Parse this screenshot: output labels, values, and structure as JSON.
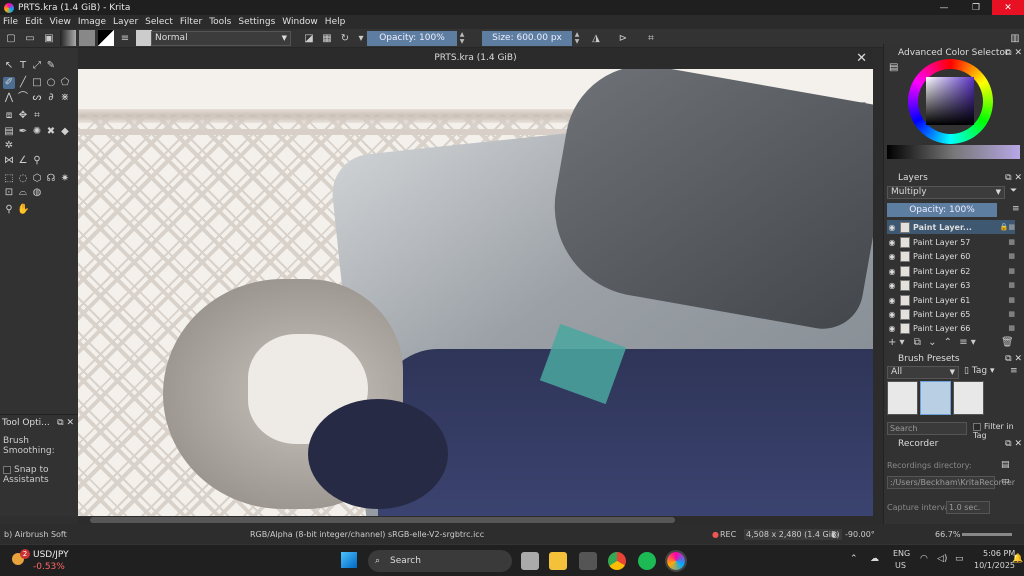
{
  "window": {
    "title": "PRTS.kra (1.4 GiB)  - Krita",
    "min": "—",
    "max": "❐",
    "close": "✕"
  },
  "menu": [
    "File",
    "Edit",
    "View",
    "Image",
    "Layer",
    "Select",
    "Filter",
    "Tools",
    "Settings",
    "Window",
    "Help"
  ],
  "toolbar": {
    "blend_mode": "Normal",
    "opacity": "Opacity: 100%",
    "size": "Size: 600.00 px"
  },
  "canvas": {
    "title": "PRTS.kra (1.4 GiB)",
    "close": "✕"
  },
  "tool_options": {
    "title": "Tool Opti...",
    "smoothing": "Brush Smoothing:",
    "snap": "Snap to Assistants"
  },
  "color_selector": {
    "title": "Advanced Color Selector"
  },
  "layers": {
    "title": "Layers",
    "blend": "Multiply",
    "opacity": "Opacity:  100%",
    "items": [
      "Paint Layer...",
      "Paint Layer 57",
      "Paint Layer 60",
      "Paint Layer 62",
      "Paint Layer 63",
      "Paint Layer 61",
      "Paint Layer 65",
      "Paint Layer 66"
    ]
  },
  "brush_presets": {
    "title": "Brush Presets",
    "filter": "All",
    "tag": "Tag",
    "search": "Search",
    "filter_in_tag": "Filter in Tag"
  },
  "recorder": {
    "title": "Recorder",
    "dir_label": "Recordings directory:",
    "dir": ":/Users/Beckham\\KritaRecorder",
    "interval_label": "Capture interval:",
    "interval": "1.0 sec."
  },
  "status": {
    "brush": "b) Airbrush Soft",
    "colorspace": "RGB/Alpha (8-bit integer/channel)  sRGB-elle-V2-srgbtrc.icc",
    "rec": "REC",
    "dimensions": "4,508 x 2,480 (1.4 GiB)",
    "rotation": "-90.00°",
    "zoom": "66.7%"
  },
  "taskbar": {
    "ticker": "USD/JPY",
    "change": "-0.53%",
    "badge": "2",
    "search": "Search",
    "lang1": "ENG",
    "lang2": "US",
    "time": "5:06 PM",
    "date": "10/1/2025"
  }
}
